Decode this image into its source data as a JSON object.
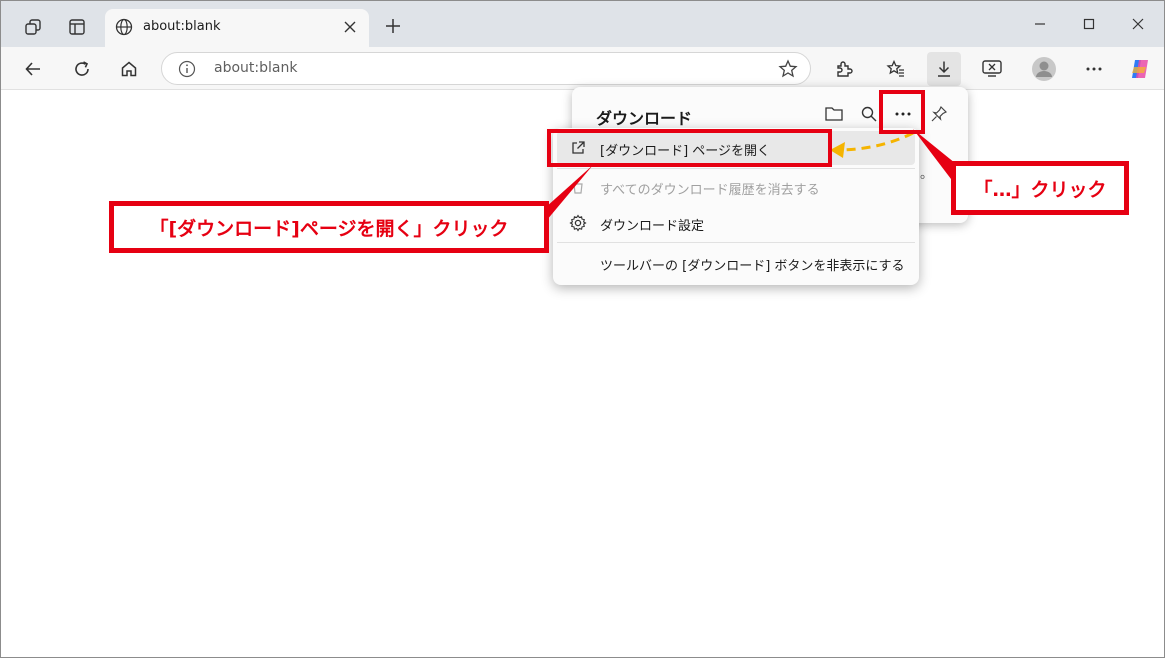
{
  "browser": {
    "tab_title": "about:blank",
    "address_url": "about:blank"
  },
  "download_panel": {
    "title": "ダウンロード",
    "body_fragment": "。"
  },
  "context_menu": {
    "items": [
      {
        "label": "[ダウンロード] ページを開く",
        "icon": "external-link-icon",
        "state": "hover"
      },
      {
        "label": "すべてのダウンロード履歴を消去する",
        "icon": "clear-history-icon",
        "state": "disabled"
      },
      {
        "label": "ダウンロード設定",
        "icon": "gear-icon",
        "state": "normal"
      },
      {
        "label": "ツールバーの [ダウンロード] ボタンを非表示にする",
        "icon": "",
        "state": "normal"
      }
    ]
  },
  "annotations": {
    "open_page_callout": "「[ダウンロード]ページを開く」クリック",
    "more_callout": "「…」クリック"
  },
  "colors": {
    "annotation_red": "#e60012",
    "arrow_yellow": "#f5b400"
  }
}
